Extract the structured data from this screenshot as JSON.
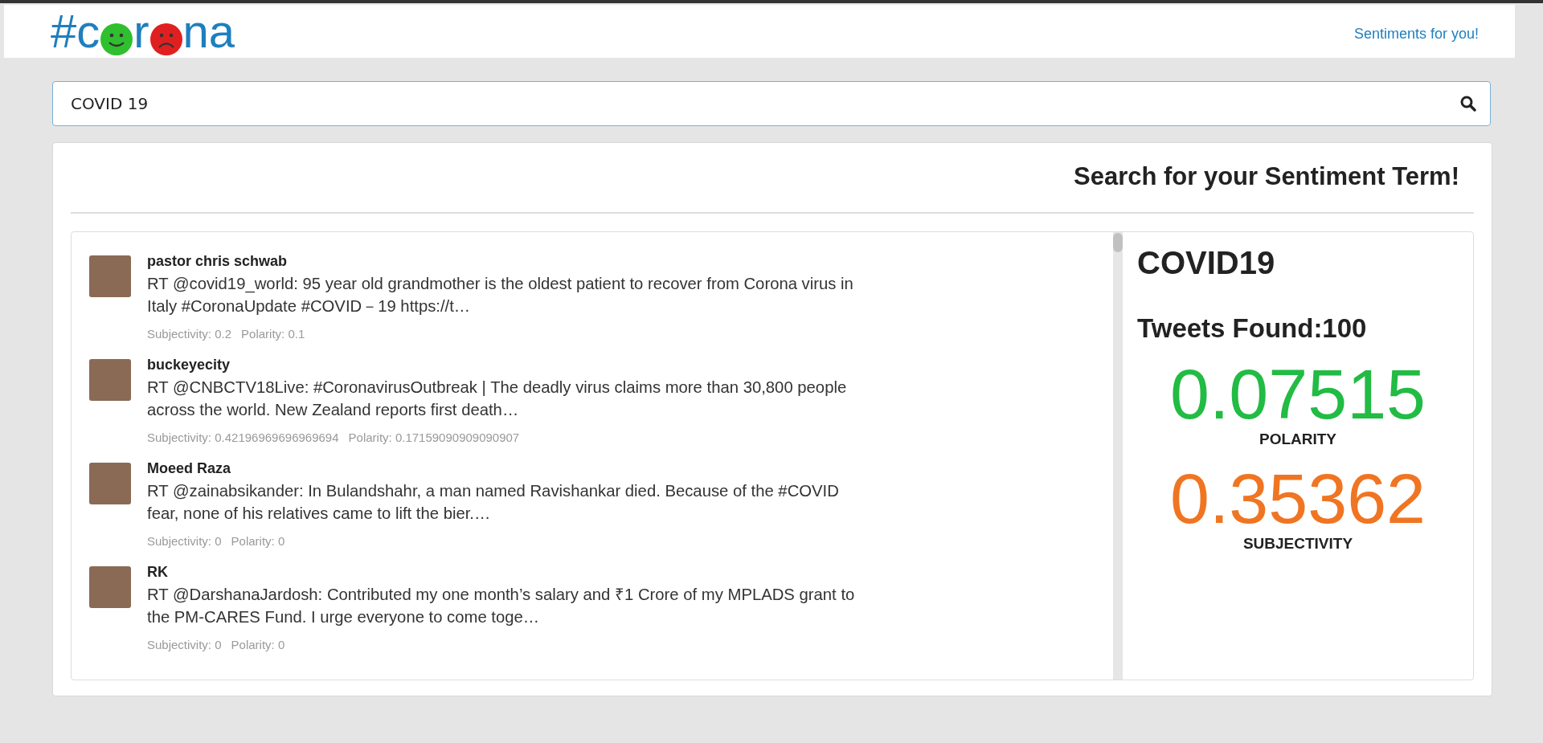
{
  "header": {
    "logo": [
      {
        "kind": "text",
        "text": "#c"
      },
      {
        "kind": "smile"
      },
      {
        "kind": "text",
        "text": "r"
      },
      {
        "kind": "frown"
      },
      {
        "kind": "text",
        "text": "na"
      }
    ],
    "link": "Sentiments for you!"
  },
  "search": {
    "value": "COVID 19"
  },
  "card": {
    "title": "Search for your Sentiment Term!",
    "tweets": [
      {
        "user": "pastor chris schwab",
        "text": "RT @covid19_world: 95 year old grandmother is the oldest patient to recover from Corona virus in Italy #CoronaUpdate #COVID－19 https://t…",
        "subjectivity": "Subjectivity: 0.2",
        "polarity": "Polarity: 0.1"
      },
      {
        "user": "buckeyecity",
        "text": "RT @CNBCTV18Live: #CoronavirusOutbreak | The deadly virus claims more than 30,800 people across the world. New Zealand reports first death…",
        "subjectivity": "Subjectivity: 0.42196969696969694",
        "polarity": "Polarity: 0.17159090909090907"
      },
      {
        "user": "Moeed Raza",
        "text": "RT @zainabsikander: In Bulandshahr, a man named Ravishankar died. Because of the #COVID fear, none of his relatives came to lift the bier.…",
        "subjectivity": "Subjectivity: 0",
        "polarity": "Polarity: 0"
      },
      {
        "user": "RK",
        "text": "RT @DarshanaJardosh: Contributed my one month’s salary and ₹1 Crore of my MPLADS grant to the PM-CARES Fund. I urge everyone to come toge…",
        "subjectivity": "Subjectivity: 0",
        "polarity": "Polarity: 0"
      }
    ],
    "stats": {
      "term": "COVID19",
      "found": "Tweets Found:100",
      "metrics": [
        {
          "value": "0.07515",
          "label": "POLARITY",
          "color": "#22bb44"
        },
        {
          "value": "0.35362",
          "label": "SUBJECTIVITY",
          "color": "#f07522"
        }
      ]
    }
  }
}
